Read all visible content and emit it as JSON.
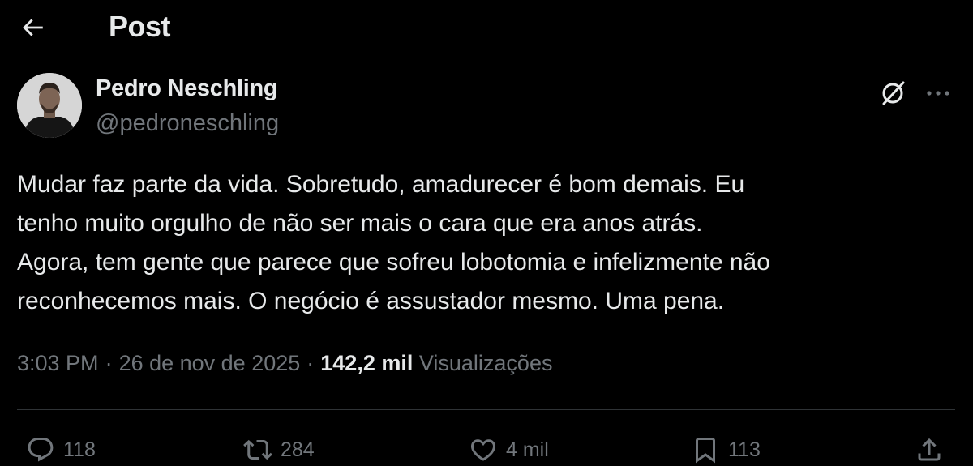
{
  "header": {
    "title": "Post",
    "back_icon": "arrow-left-icon"
  },
  "author": {
    "name": "Pedro Neschling",
    "handle": "@pedroneschling",
    "avatar_icon": "avatar-photo"
  },
  "post": {
    "text_lines": [
      "Mudar faz parte da vida. Sobretudo, amadurecer é bom demais. Eu",
      "tenho muito orgulho de não ser mais o cara que era anos atrás.",
      "Agora, tem gente que parece que sofreu lobotomia e infelizmente não",
      "reconhecemos mais. O negócio é assustador mesmo. Uma pena."
    ],
    "time": "3:03 PM",
    "date": "26 de nov de 2025",
    "views_count": "142,2 mil",
    "views_label": "Visualizações"
  },
  "actions": {
    "replies": "118",
    "reposts": "284",
    "likes": "4 mil",
    "bookmarks": "113"
  },
  "colors": {
    "background": "#000000",
    "text_primary": "#e7e9ea",
    "text_secondary": "#71767b",
    "divider": "#2f3336"
  }
}
